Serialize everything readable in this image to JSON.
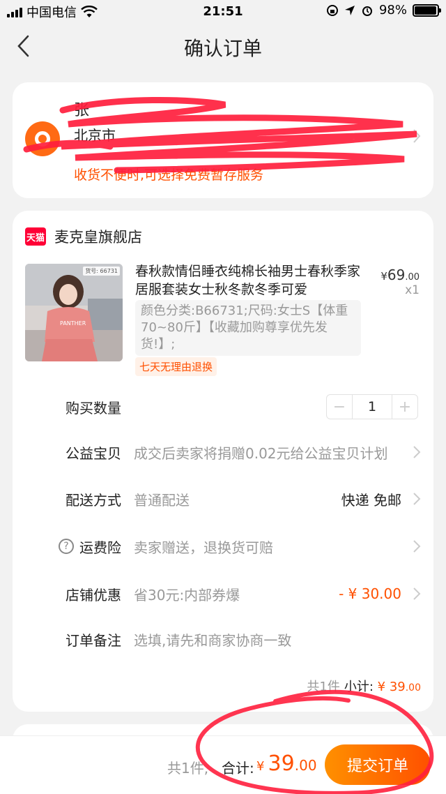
{
  "status_bar": {
    "carrier": "中国电信",
    "time": "21:51",
    "battery": "98%"
  },
  "nav": {
    "title": "确认订单"
  },
  "address": {
    "name": "张",
    "line": "北京市",
    "hint": "收货不便时,可选择免费暂存服务"
  },
  "shop": {
    "badge": "天猫",
    "name": "麦克皇旗舰店"
  },
  "product": {
    "thumb_tag": "货号: 66731",
    "title": "春秋款情侣睡衣纯棉长袖男士春秋季家居服套装女士秋冬款冬季可爱",
    "price_currency": "¥",
    "price_int": "69",
    "price_dec": ".00",
    "quantity": "x1",
    "sku": "颜色分类:B66731;尺码:女士S【体重70~80斤】【收藏加购尊享优先发货!】;",
    "return_badge": "七天无理由退换"
  },
  "rows": {
    "qty_label": "购买数量",
    "qty_minus": "−",
    "qty_value": "1",
    "qty_plus": "+",
    "charity_label": "公益宝贝",
    "charity_value": "成交后卖家将捐赠0.02元给公益宝贝计划",
    "delivery_label": "配送方式",
    "delivery_value": "普通配送",
    "delivery_right": "快递 免邮",
    "insurance_label": "运费险",
    "insurance_value": "卖家赠送，退换货可赔",
    "discount_label": "店铺优惠",
    "discount_value": "省30元:内部券爆",
    "discount_right": "- ¥ 30.00",
    "note_label": "订单备注",
    "note_placeholder": "选填,请先和商家协商一致"
  },
  "subtotal": {
    "count": "共1件",
    "label": "小计:",
    "currency": "¥",
    "int": "39",
    "dec": ".00"
  },
  "bottom": {
    "count": "共1件,",
    "total_label": "合计:",
    "currency": "¥",
    "total_int": "39",
    "total_dec": ".00",
    "submit": "提交订单"
  },
  "colors": {
    "accent": "#ff5000",
    "tmall": "#ff0036",
    "annotation": "#ff1f3d"
  }
}
